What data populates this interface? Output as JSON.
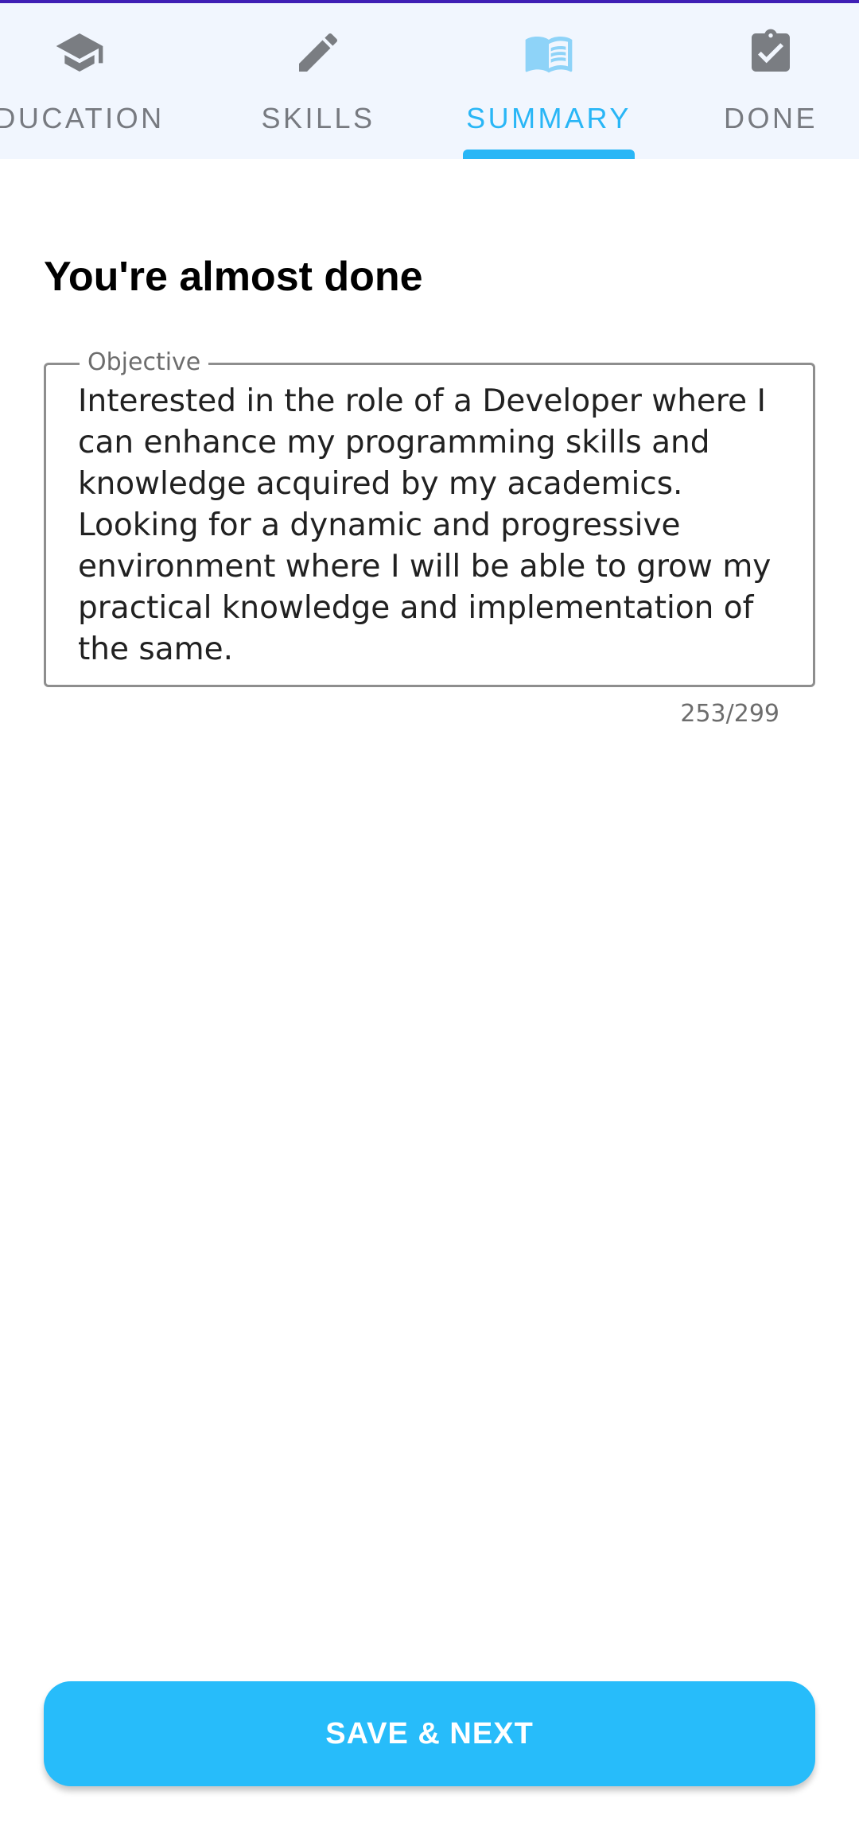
{
  "tabs": [
    {
      "label": "DUCATION",
      "icon": "graduation-cap-icon",
      "active": false
    },
    {
      "label": "SKILLS",
      "icon": "pencil-icon",
      "active": false
    },
    {
      "label": "SUMMARY",
      "icon": "book-icon",
      "active": true
    },
    {
      "label": "DONE",
      "icon": "clipboard-check-icon",
      "active": false
    }
  ],
  "colors": {
    "accent": "#29b6f6",
    "inactive_tab": "#777a80",
    "tabbar_background": "#f1f6fe",
    "status_strip": "#3f1fb5"
  },
  "main": {
    "title": "You're almost done",
    "objective": {
      "label": "Objective",
      "value": "Interested in the role of a Developer where I\ncan enhance my programming skills and\nknowledge acquired by my academics.\nLooking for a dynamic and progressive\nenvironment where I will be able to grow my\npractical knowledge and implementation of\nthe same.",
      "counter": "253/299"
    }
  },
  "footer": {
    "save_label": "SAVE & NEXT"
  }
}
